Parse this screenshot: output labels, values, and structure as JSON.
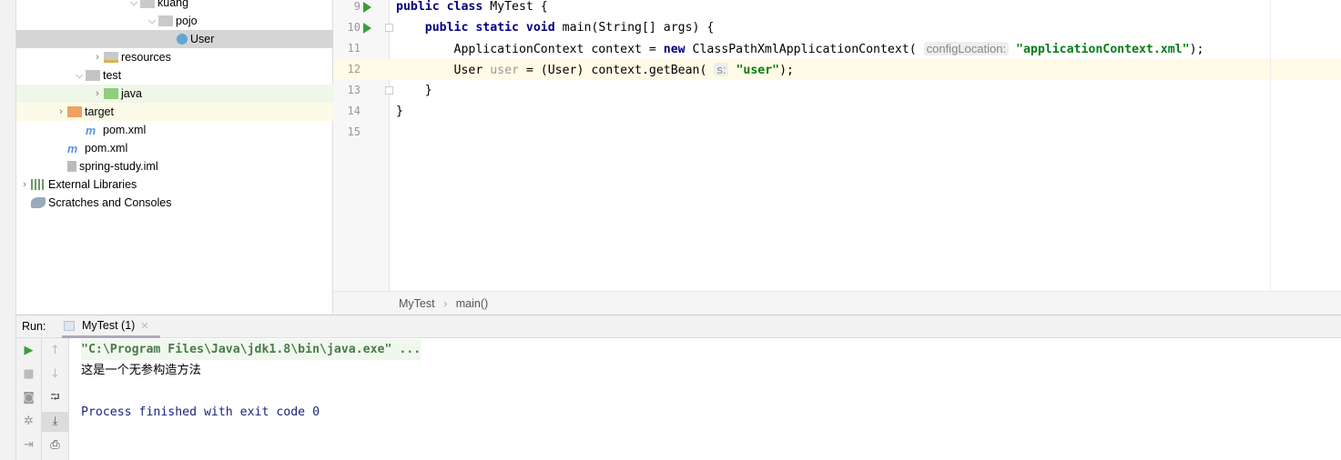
{
  "tree": {
    "items": [
      {
        "label": "kuang",
        "indent": 7,
        "chev": "v",
        "icon": "package"
      },
      {
        "label": "pojo",
        "indent": 8,
        "chev": "v",
        "icon": "package"
      },
      {
        "label": "User",
        "indent": 9,
        "chev": "",
        "icon": "class",
        "selected": true
      },
      {
        "label": "resources",
        "indent": 5,
        "chev": ">",
        "icon": "resources"
      },
      {
        "label": "test",
        "indent": 4,
        "chev": "v",
        "icon": "folder"
      },
      {
        "label": "java",
        "indent": 5,
        "chev": ">",
        "icon": "test-folder",
        "tint": "#eef7e8"
      },
      {
        "label": "target",
        "indent": 3,
        "chev": ">",
        "icon": "excluded-folder",
        "tint": "#fbfbe8"
      },
      {
        "label": "pom.xml",
        "indent": 4,
        "chev": "",
        "icon": "maven"
      },
      {
        "label": "pom.xml",
        "indent": 3,
        "chev": "",
        "icon": "maven"
      },
      {
        "label": "spring-study.iml",
        "indent": 3,
        "chev": "",
        "icon": "iml-file"
      },
      {
        "label": "External Libraries",
        "indent": 1,
        "chev": ">",
        "icon": "libraries"
      },
      {
        "label": "Scratches and Consoles",
        "indent": 1,
        "chev": "",
        "icon": "scratches"
      }
    ]
  },
  "editor": {
    "line_numbers": [
      "9",
      "10",
      "11",
      "12",
      "13",
      "14",
      "15"
    ],
    "lines": [
      [
        {
          "t": "public class ",
          "c": "kw"
        },
        {
          "t": "MyTest {"
        }
      ],
      [
        {
          "t": "    "
        },
        {
          "t": "public static void ",
          "c": "kw"
        },
        {
          "t": "main(String[] args) {"
        }
      ],
      [
        {
          "t": "        ApplicationContext context = "
        },
        {
          "t": "new ",
          "c": "kw"
        },
        {
          "t": "ClassPathXmlApplicationContext( "
        },
        {
          "t": "configLocation:",
          "c": "hint"
        },
        {
          "t": " "
        },
        {
          "t": "\"applicationContext.xml\"",
          "c": "str"
        },
        {
          "t": ");"
        }
      ],
      [
        {
          "t": "        User "
        },
        {
          "t": "user",
          "c": "unused"
        },
        {
          "t": " = (User) context.getBean( "
        },
        {
          "t": "s:",
          "c": "hint"
        },
        {
          "t": " "
        },
        {
          "t": "\"user\"",
          "c": "str"
        },
        {
          "t": ");"
        }
      ],
      [
        {
          "t": "    }"
        }
      ],
      [
        {
          "t": "}"
        }
      ],
      [
        {
          "t": ""
        }
      ]
    ],
    "current_line_index": 3,
    "breadcrumb": [
      "MyTest",
      "main()"
    ]
  },
  "run": {
    "label": "Run:",
    "tab": "MyTest (1)",
    "console": [
      {
        "text": "\"C:\\Program Files\\Java\\jdk1.8\\bin\\java.exe\" ...",
        "color": "#4a7a4a",
        "bg": "#f0f8ee",
        "bold": true
      },
      {
        "text": "这是一个无参构造方法",
        "color": "#000"
      },
      {
        "text": "",
        "color": "#000"
      },
      {
        "text": "Process finished with exit code 0",
        "color": "#1a237e"
      }
    ]
  },
  "colors": {
    "accent_green": "#3a9e3a",
    "selection": "#d5d5d5",
    "current_line": "#fffbe6"
  }
}
